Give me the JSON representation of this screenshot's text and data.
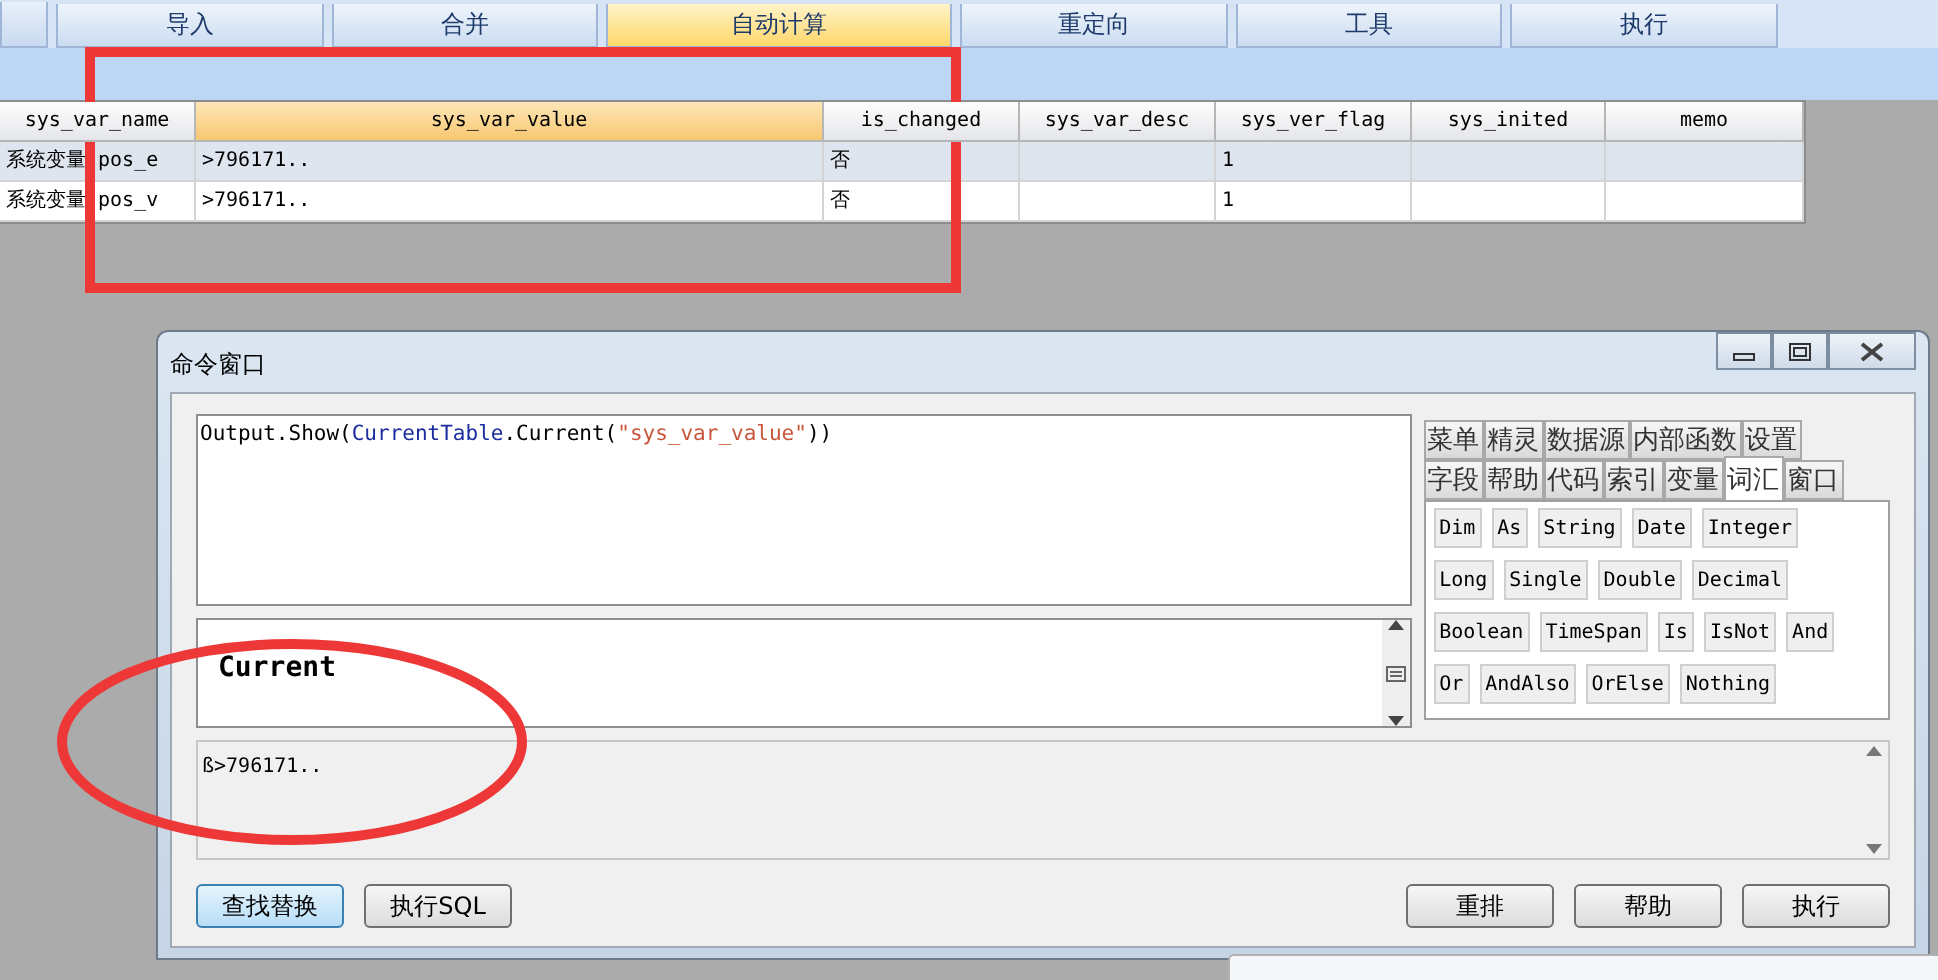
{
  "toolbar": [
    {
      "label": "导入",
      "selected": false
    },
    {
      "label": "合并",
      "selected": false
    },
    {
      "label": "自动计算",
      "selected": true
    },
    {
      "label": "重定向",
      "selected": false
    },
    {
      "label": "工具",
      "selected": false
    },
    {
      "label": "执行",
      "selected": false
    }
  ],
  "table": {
    "columns": [
      {
        "label": "sys_var_name",
        "selected": false
      },
      {
        "label": "sys_var_value",
        "selected": true
      },
      {
        "label": "is_changed",
        "selected": false
      },
      {
        "label": "sys_var_desc",
        "selected": false
      },
      {
        "label": "sys_ver_flag",
        "selected": false
      },
      {
        "label": "sys_inited",
        "selected": false
      },
      {
        "label": "memo",
        "selected": false
      }
    ],
    "rows": [
      {
        "selected": true,
        "cells": [
          "系统变量 pos_e",
          ">796171..",
          "否",
          "",
          "1",
          "",
          ""
        ]
      },
      {
        "selected": false,
        "cells": [
          "系统变量 pos_v",
          ">796171..",
          "否",
          "",
          "1",
          "",
          ""
        ]
      }
    ]
  },
  "command_window": {
    "title": "命令窗口",
    "code": [
      {
        "kind": "plain",
        "text": "Output.Show("
      },
      {
        "kind": "type",
        "text": "CurrentTable"
      },
      {
        "kind": "plain",
        "text": ".Current("
      },
      {
        "kind": "string",
        "text": "\"sys_var_value\""
      },
      {
        "kind": "plain",
        "text": "))"
      }
    ],
    "suggestion": "Current",
    "tab_rows": [
      [
        {
          "label": "菜单",
          "selected": false
        },
        {
          "label": "精灵",
          "selected": false
        },
        {
          "label": "数据源",
          "selected": false
        },
        {
          "label": "内部函数",
          "selected": false
        },
        {
          "label": "设置",
          "selected": false
        }
      ],
      [
        {
          "label": "字段",
          "selected": false
        },
        {
          "label": "帮助",
          "selected": false
        },
        {
          "label": "代码",
          "selected": false
        },
        {
          "label": "索引",
          "selected": false
        },
        {
          "label": "变量",
          "selected": false
        },
        {
          "label": "词汇",
          "selected": true
        },
        {
          "label": "窗口",
          "selected": false
        }
      ]
    ],
    "keywords": [
      [
        "Dim",
        "As",
        "String",
        "Date",
        "Integer"
      ],
      [
        "Long",
        "Single",
        "Double",
        "Decimal"
      ],
      [
        "Boolean",
        "TimeSpan",
        "Is",
        "IsNot",
        "And"
      ],
      [
        "Or",
        "AndAlso",
        "OrElse",
        "Nothing"
      ]
    ],
    "output": "ß>796171..",
    "left_buttons": [
      {
        "label": "查找替换",
        "focused": true
      },
      {
        "label": "执行SQL",
        "focused": false
      }
    ],
    "right_buttons": [
      {
        "label": "重排",
        "focused": false
      },
      {
        "label": "帮助",
        "focused": false
      },
      {
        "label": "执行",
        "focused": false
      }
    ]
  }
}
